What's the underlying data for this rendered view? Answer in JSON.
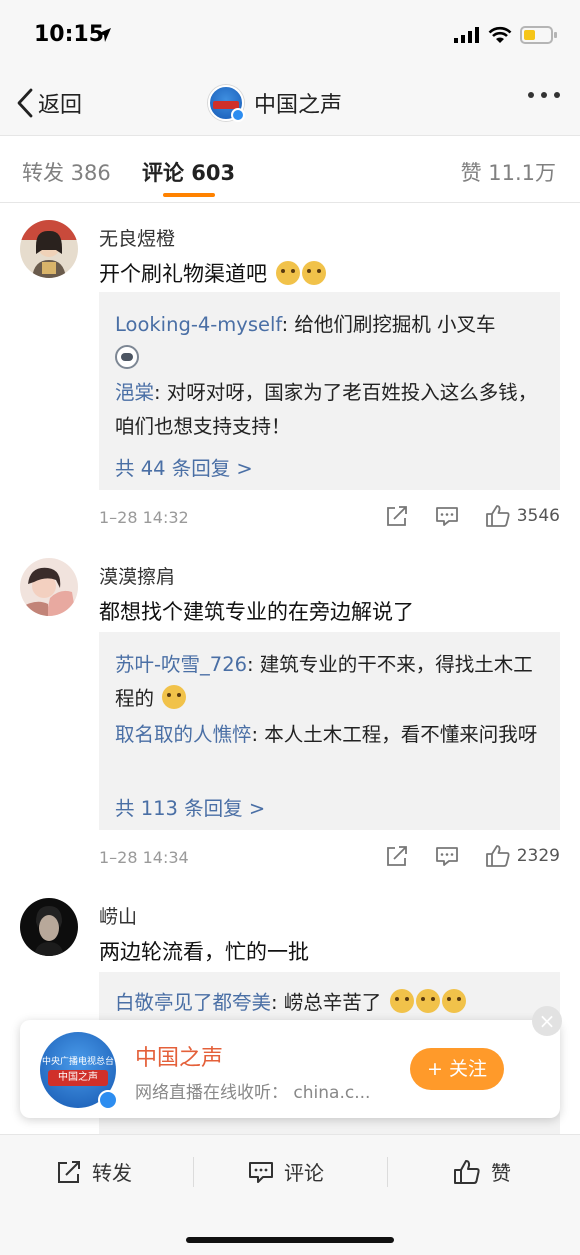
{
  "status_bar": {
    "time": "10:15"
  },
  "nav": {
    "back_label": "返回",
    "title": "中国之声"
  },
  "tabs": {
    "repost": "转发 386",
    "comments": "评论 603",
    "likes": "赞 11.1万",
    "accent_color": "#ff8200"
  },
  "comments": [
    {
      "username": "无良煜橙",
      "text": "开个刷礼物渠道吧",
      "replies": [
        {
          "name": "Looking-4-myself",
          "text": ": 给他们刷挖掘机 小叉车"
        },
        {
          "name": "浥棠",
          "text": ": 对呀对呀，国家为了老百姓投入这么多钱，咱们也想支持支持！"
        }
      ],
      "more_replies": "共 44 条回复 >",
      "time": "1–28 14:32",
      "likes": "3546"
    },
    {
      "username": "漠漠擦肩",
      "text": "都想找个建筑专业的在旁边解说了",
      "replies": [
        {
          "name": "苏叶-吹雪_726",
          "text": ": 建筑专业的干不来，得找土木工程的"
        },
        {
          "name": "取名取的人憔悴",
          "text": ": 本人土木工程，看不懂来问我呀"
        }
      ],
      "more_replies": "共 113 条回复 >",
      "time": "1–28 14:34",
      "likes": "2329"
    },
    {
      "username": "崂山",
      "text": "两边轮流看，忙的一批",
      "replies": [
        {
          "name": "白敬亭见了都夸美",
          "text": ": 崂总辛苦了"
        }
      ]
    }
  ],
  "promo": {
    "name": "中国之声",
    "description": "网络直播在线收听： china.c...",
    "follow_label": "+ 关注",
    "close_label": "×",
    "avatar_top_text": "中央广播电视总台",
    "avatar_band_text": "中国之声"
  },
  "bottom_bar": {
    "repost": "转发",
    "comment": "评论",
    "like": "赞"
  },
  "colors": {
    "link": "#4a6fa5",
    "promo_name": "#e4603a",
    "follow_button": "#ff9a2a"
  }
}
